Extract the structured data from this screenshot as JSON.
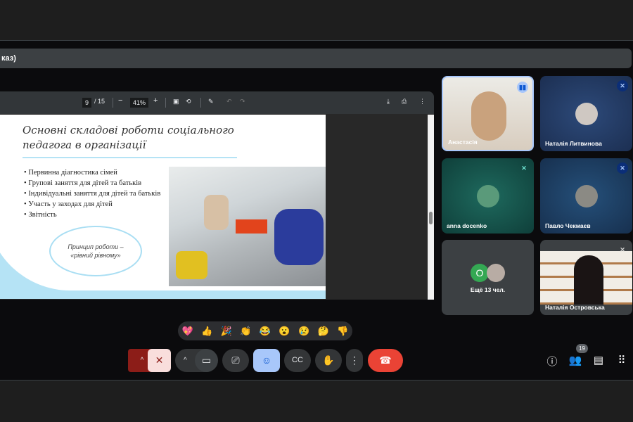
{
  "window_title": "каз)",
  "pdf_toolbar": {
    "page": "9",
    "total": "/ 15",
    "zoom": "41%"
  },
  "slide": {
    "title_line1": "Основні складові роботи соціального",
    "title_line2": "педагога в організації",
    "bullets": [
      "Первинна діагностика сімей",
      "Групові заняття для дітей та батьків",
      "Індивідуальні заняття для дітей та батьків",
      "Участь у заходах для дітей",
      "Звітність"
    ],
    "oval_line1": "Принцип роботи –",
    "oval_line2": "«рівний рівному»"
  },
  "participants": [
    {
      "name": "Анастасія"
    },
    {
      "name": "Наталія Литвинова"
    },
    {
      "name": "anna docenko"
    },
    {
      "name": "Павло Чекмаєв"
    },
    {
      "name": "Наталія Островська"
    }
  ],
  "others": {
    "initial": "O",
    "label": "Ещё 13 чел."
  },
  "reactions": [
    "💖",
    "👍",
    "🎉",
    "👏",
    "😂",
    "😮",
    "😢",
    "🤔",
    "👎"
  ],
  "participant_count": "19",
  "colors": {
    "end_call": "#ea4335",
    "mic_off": "#f9dedc",
    "emoji_active": "#a8c7fa"
  }
}
